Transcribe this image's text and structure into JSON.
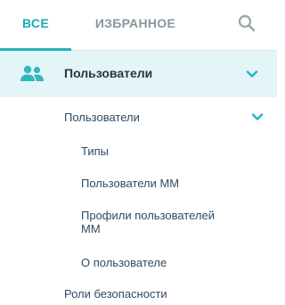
{
  "tabs": {
    "all": "ВСЕ",
    "favorites": "ИЗБРАННОЕ"
  },
  "icons": {
    "search": "search-icon",
    "users": "users-icon",
    "expand": "chevron-down-icon"
  },
  "colors": {
    "accent": "#22b4c0",
    "active_tab_text": "#1ba9b4",
    "inactive_tab_text": "#8a959c",
    "section_bg": "#e3f5f6",
    "link_text": "#2e4a66"
  },
  "menu": {
    "section": {
      "label": "Пользователи",
      "expanded": true
    },
    "group": {
      "label": "Пользователи",
      "expanded": true,
      "items": [
        {
          "label": "Типы"
        },
        {
          "label": "Пользователи ММ"
        },
        {
          "label": "Профили пользователей ММ"
        },
        {
          "label": "О пользователе"
        }
      ]
    },
    "after": [
      {
        "label": "Роли безопасности"
      }
    ]
  }
}
